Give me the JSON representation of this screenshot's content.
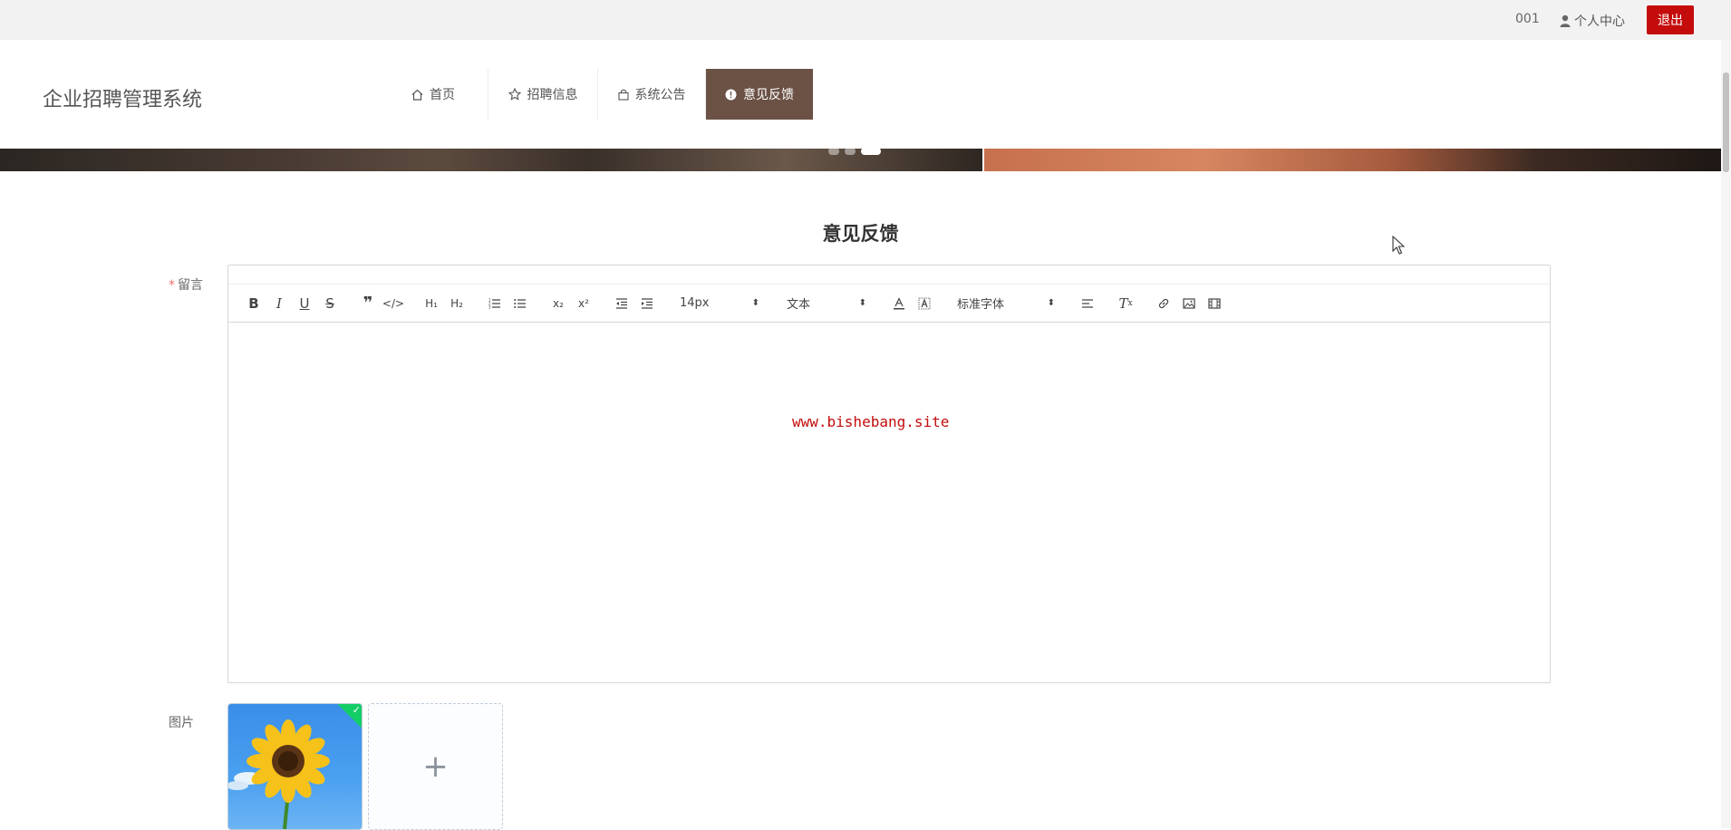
{
  "topbar": {
    "user_id": "001",
    "user_center": "个人中心",
    "logout": "退出"
  },
  "header": {
    "brand": "企业招聘管理系统",
    "nav": [
      {
        "label": "首页",
        "icon": "home-icon"
      },
      {
        "label": "招聘信息",
        "icon": "star-icon"
      },
      {
        "label": "系统公告",
        "icon": "bag-icon"
      },
      {
        "label": "意见反馈",
        "icon": "info-icon",
        "active": true
      }
    ]
  },
  "banner": {
    "slides": 3,
    "active_slide": 3
  },
  "form": {
    "title": "意见反馈",
    "message_label": "留言",
    "image_label": "图片",
    "toolbar": {
      "size": "14px",
      "header": "文本",
      "font": "标准字体"
    },
    "watermark": "www.bishebang.site"
  },
  "colors": {
    "accent": "#6b5245",
    "logout": "#c40c0c",
    "success": "#13ce66"
  }
}
